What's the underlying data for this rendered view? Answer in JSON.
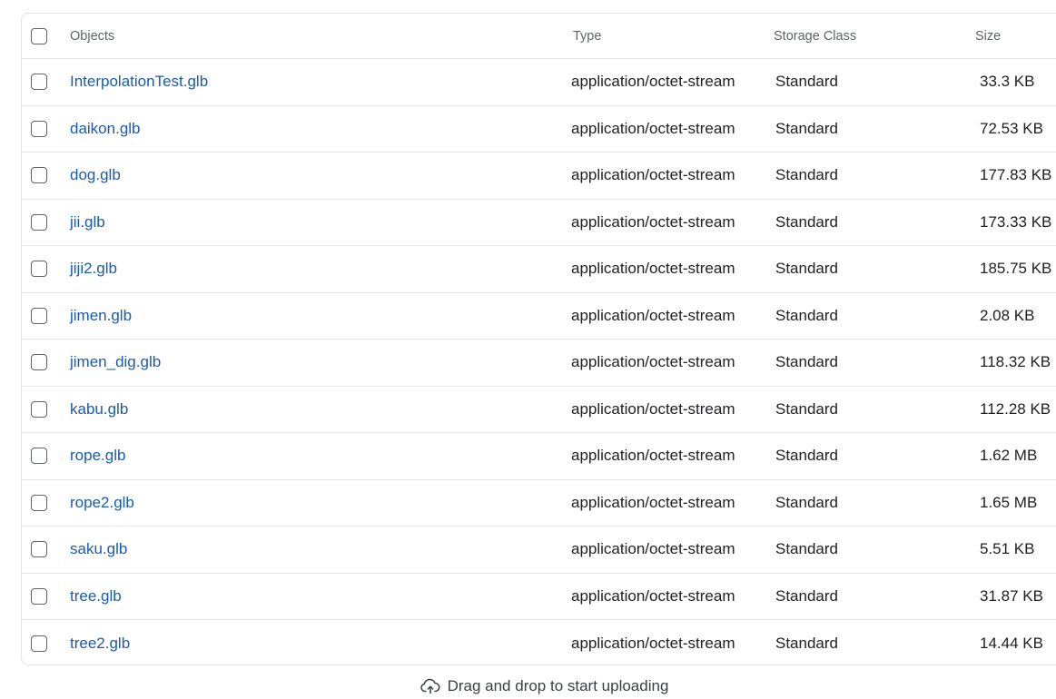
{
  "table": {
    "headers": {
      "objects": "Objects",
      "type": "Type",
      "storage_class": "Storage Class",
      "size": "Size"
    },
    "rows": [
      {
        "name": "InterpolationTest.glb",
        "type": "application/octet-stream",
        "storage_class": "Standard",
        "size": "33.3 KB"
      },
      {
        "name": "daikon.glb",
        "type": "application/octet-stream",
        "storage_class": "Standard",
        "size": "72.53 KB"
      },
      {
        "name": "dog.glb",
        "type": "application/octet-stream",
        "storage_class": "Standard",
        "size": "177.83 KB"
      },
      {
        "name": "jii.glb",
        "type": "application/octet-stream",
        "storage_class": "Standard",
        "size": "173.33 KB"
      },
      {
        "name": "jiji2.glb",
        "type": "application/octet-stream",
        "storage_class": "Standard",
        "size": "185.75 KB"
      },
      {
        "name": "jimen.glb",
        "type": "application/octet-stream",
        "storage_class": "Standard",
        "size": "2.08 KB"
      },
      {
        "name": "jimen_dig.glb",
        "type": "application/octet-stream",
        "storage_class": "Standard",
        "size": "118.32 KB"
      },
      {
        "name": "kabu.glb",
        "type": "application/octet-stream",
        "storage_class": "Standard",
        "size": "112.28 KB"
      },
      {
        "name": "rope.glb",
        "type": "application/octet-stream",
        "storage_class": "Standard",
        "size": "1.62 MB"
      },
      {
        "name": "rope2.glb",
        "type": "application/octet-stream",
        "storage_class": "Standard",
        "size": "1.65 MB"
      },
      {
        "name": "saku.glb",
        "type": "application/octet-stream",
        "storage_class": "Standard",
        "size": "5.51 KB"
      },
      {
        "name": "tree.glb",
        "type": "application/octet-stream",
        "storage_class": "Standard",
        "size": "31.87 KB"
      },
      {
        "name": "tree2.glb",
        "type": "application/octet-stream",
        "storage_class": "Standard",
        "size": "14.44 KB"
      }
    ]
  },
  "dropzone": {
    "label": "Drag and drop to start uploading",
    "icon": "cloud-upload-icon"
  },
  "colors": {
    "link": "#1a5bb0",
    "border": "#e6e6e6"
  }
}
